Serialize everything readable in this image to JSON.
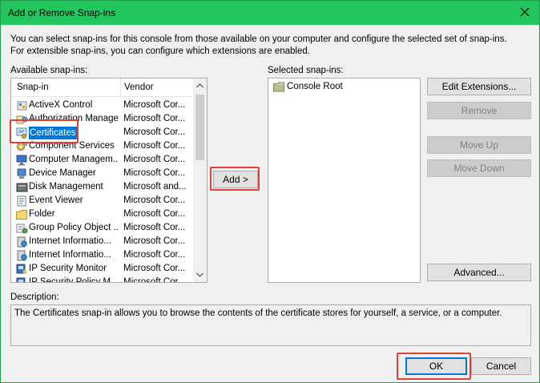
{
  "window": {
    "title": "Add or Remove Snap-ins"
  },
  "intro": "You can select snap-ins for this console from those available on your computer and configure the selected set of snap-ins. For extensible snap-ins, you can configure which extensions are enabled.",
  "available": {
    "label": "Available snap-ins:",
    "columns": [
      "Snap-in",
      "Vendor"
    ],
    "rows": [
      {
        "name": "ActiveX Control",
        "vendor": "Microsoft Cor...",
        "icon": "activex-icon"
      },
      {
        "name": "Authorization Manager",
        "vendor": "Microsoft Cor...",
        "icon": "authorization-icon"
      },
      {
        "name": "Certificates",
        "vendor": "Microsoft Cor...",
        "icon": "certificate-icon",
        "selected": true
      },
      {
        "name": "Component Services",
        "vendor": "Microsoft Cor...",
        "icon": "component-services-icon"
      },
      {
        "name": "Computer Managem...",
        "vendor": "Microsoft Cor...",
        "icon": "computer-management-icon"
      },
      {
        "name": "Device Manager",
        "vendor": "Microsoft Cor...",
        "icon": "device-manager-icon"
      },
      {
        "name": "Disk Management",
        "vendor": "Microsoft and...",
        "icon": "disk-icon"
      },
      {
        "name": "Event Viewer",
        "vendor": "Microsoft Cor...",
        "icon": "event-viewer-icon"
      },
      {
        "name": "Folder",
        "vendor": "Microsoft Cor...",
        "icon": "folder-icon"
      },
      {
        "name": "Group Policy Object ...",
        "vendor": "Microsoft Cor...",
        "icon": "group-policy-icon"
      },
      {
        "name": "Internet Informatio...",
        "vendor": "Microsoft Cor...",
        "icon": "iis-icon"
      },
      {
        "name": "Internet Informatio...",
        "vendor": "Microsoft Cor...",
        "icon": "iis-icon"
      },
      {
        "name": "IP Security Monitor",
        "vendor": "Microsoft Cor...",
        "icon": "ip-security-icon"
      },
      {
        "name": "IP Security Policy M...",
        "vendor": "Microsoft Cor...",
        "icon": "ip-security-icon"
      }
    ]
  },
  "add_button": "Add >",
  "selected": {
    "label": "Selected snap-ins:",
    "items": [
      {
        "name": "Console Root",
        "icon": "folder-icon"
      }
    ]
  },
  "side_buttons": {
    "edit_extensions": "Edit Extensions...",
    "remove": "Remove",
    "move_up": "Move Up",
    "move_down": "Move Down",
    "advanced": "Advanced..."
  },
  "description": {
    "label": "Description:",
    "text": "The Certificates snap-in allows you to browse the contents of the certificate stores for yourself, a service, or a computer."
  },
  "footer": {
    "ok": "OK",
    "cancel": "Cancel"
  },
  "colors": {
    "titlebar": "#22c55e",
    "selection": "#0078d7",
    "highlight": "#e0403a"
  }
}
